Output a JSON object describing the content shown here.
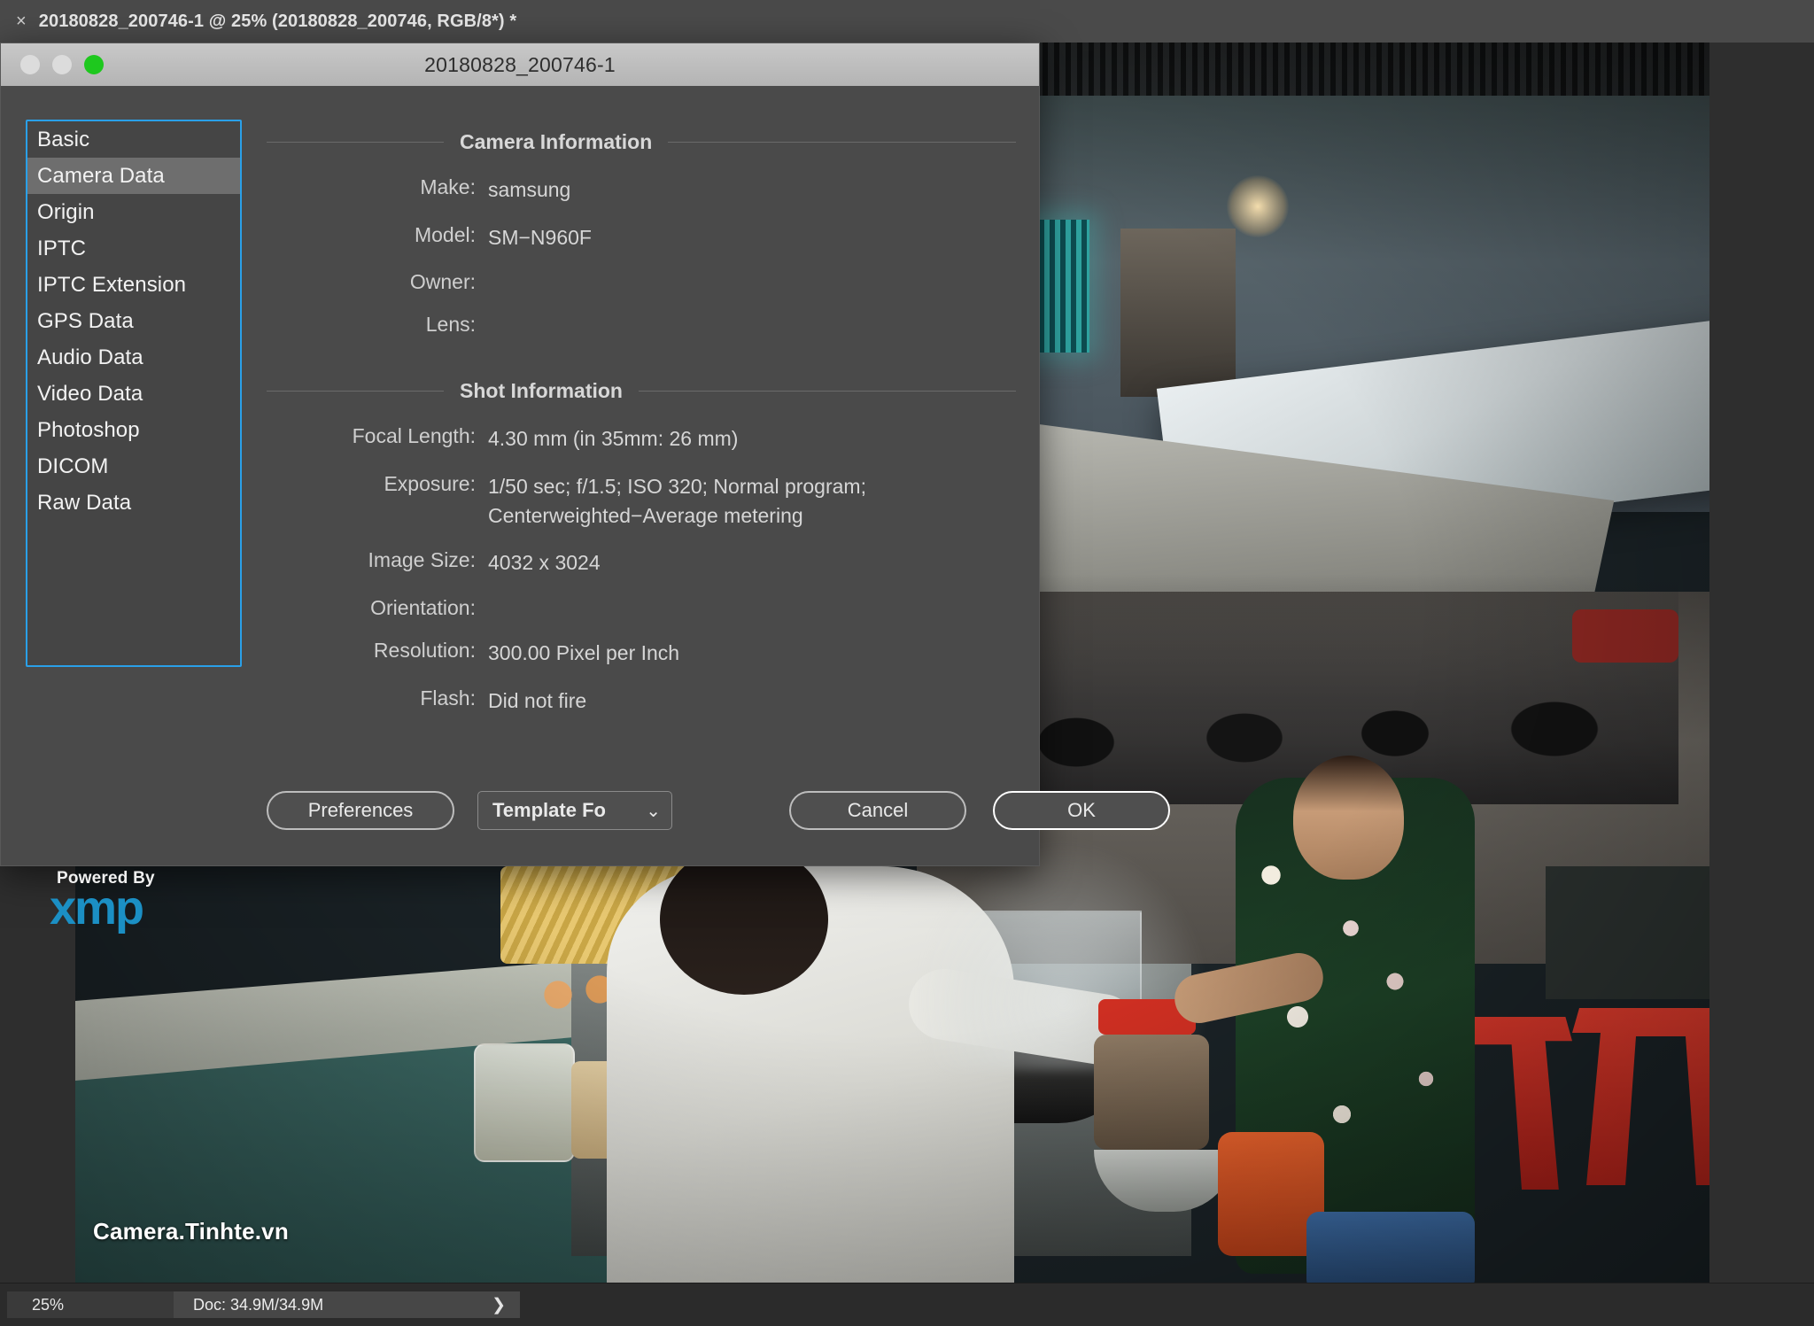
{
  "app": {
    "tab_title": "20180828_200746-1 @ 25% (20180828_200746, RGB/8*) *",
    "close_icon": "×"
  },
  "statusbar": {
    "zoom": "25%",
    "doc": "Doc: 34.9M/34.9M",
    "expand_icon": "❯"
  },
  "photo": {
    "watermark": "Camera.Tinhte.vn"
  },
  "dialog": {
    "title": "20180828_200746-1",
    "traffic_lights": [
      "close-button",
      "minimize-button",
      "zoom-button"
    ],
    "sidebar": {
      "items": [
        {
          "label": "Basic",
          "selected": false
        },
        {
          "label": "Camera Data",
          "selected": true
        },
        {
          "label": "Origin",
          "selected": false
        },
        {
          "label": "IPTC",
          "selected": false
        },
        {
          "label": "IPTC Extension",
          "selected": false
        },
        {
          "label": "GPS Data",
          "selected": false
        },
        {
          "label": "Audio Data",
          "selected": false
        },
        {
          "label": "Video Data",
          "selected": false
        },
        {
          "label": "Photoshop",
          "selected": false
        },
        {
          "label": "DICOM",
          "selected": false
        },
        {
          "label": "Raw Data",
          "selected": false
        }
      ]
    },
    "xmp": {
      "powered_by": "Powered By",
      "logo_text": "xmp"
    },
    "sections": [
      {
        "title": "Camera Information",
        "fields": [
          {
            "label": "Make:",
            "value": "samsung"
          },
          {
            "label": "Model:",
            "value": "SM−N960F"
          },
          {
            "label": "Owner:",
            "value": ""
          },
          {
            "label": "Lens:",
            "value": ""
          }
        ]
      },
      {
        "title": "Shot Information",
        "fields": [
          {
            "label": "Focal Length:",
            "value": "4.30 mm   (in 35mm: 26 mm)"
          },
          {
            "label": "Exposure:",
            "value": "1/50 sec;   f/1.5;   ISO 320;   Normal program;\nCenterweighted−Average metering"
          },
          {
            "label": "Image Size:",
            "value": "4032 x 3024"
          },
          {
            "label": "Orientation:",
            "value": ""
          },
          {
            "label": "Resolution:",
            "value": "300.00 Pixel per Inch"
          },
          {
            "label": "Flash:",
            "value": "Did not fire"
          }
        ]
      }
    ],
    "buttons": {
      "preferences": "Preferences",
      "template": "Template Fo",
      "template_chevron": "⌄",
      "cancel": "Cancel",
      "ok": "OK"
    }
  },
  "colors": {
    "accent_focus": "#2aa0e8",
    "xmp_blue": "#1b8fc4",
    "dialog_bg": "#4a4a4a",
    "selected_row": "#6e6e6e",
    "green_light": "#1ec81e"
  }
}
